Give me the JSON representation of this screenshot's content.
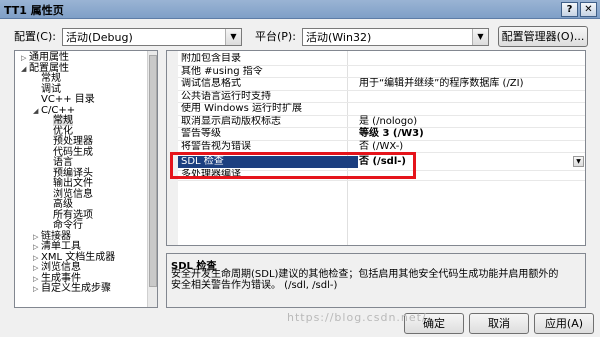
{
  "window": {
    "title": "TT1 属性页",
    "help": "?",
    "close": "✕"
  },
  "config": {
    "label": "配置(C):",
    "value": "活动(Debug)"
  },
  "platform": {
    "label": "平台(P):",
    "value": "活动(Win32)"
  },
  "config_manager": "配置管理器(O)...",
  "tree": [
    {
      "label": "通用属性",
      "indent": 0,
      "exp": "▷"
    },
    {
      "label": "配置属性",
      "indent": 0,
      "exp": "◢"
    },
    {
      "label": "常规",
      "indent": 1,
      "exp": ""
    },
    {
      "label": "调试",
      "indent": 1,
      "exp": ""
    },
    {
      "label": "VC++ 目录",
      "indent": 1,
      "exp": ""
    },
    {
      "label": "C/C++",
      "indent": 1,
      "exp": "◢"
    },
    {
      "label": "常规",
      "indent": 2,
      "exp": "",
      "selected": true
    },
    {
      "label": "优化",
      "indent": 2,
      "exp": ""
    },
    {
      "label": "预处理器",
      "indent": 2,
      "exp": ""
    },
    {
      "label": "代码生成",
      "indent": 2,
      "exp": ""
    },
    {
      "label": "语言",
      "indent": 2,
      "exp": ""
    },
    {
      "label": "预编译头",
      "indent": 2,
      "exp": ""
    },
    {
      "label": "输出文件",
      "indent": 2,
      "exp": ""
    },
    {
      "label": "浏览信息",
      "indent": 2,
      "exp": ""
    },
    {
      "label": "高级",
      "indent": 2,
      "exp": ""
    },
    {
      "label": "所有选项",
      "indent": 2,
      "exp": ""
    },
    {
      "label": "命令行",
      "indent": 2,
      "exp": ""
    },
    {
      "label": "链接器",
      "indent": 1,
      "exp": "▷"
    },
    {
      "label": "清单工具",
      "indent": 1,
      "exp": "▷"
    },
    {
      "label": "XML 文档生成器",
      "indent": 1,
      "exp": "▷"
    },
    {
      "label": "浏览信息",
      "indent": 1,
      "exp": "▷"
    },
    {
      "label": "生成事件",
      "indent": 1,
      "exp": "▷"
    },
    {
      "label": "自定义生成步骤",
      "indent": 1,
      "exp": "▷"
    }
  ],
  "grid": [
    {
      "name": "附加包含目录",
      "value": ""
    },
    {
      "name": "其他 #using 指令",
      "value": ""
    },
    {
      "name": "调试信息格式",
      "value": "用于“编辑并继续”的程序数据库 (/ZI)"
    },
    {
      "name": "公共语言运行时支持",
      "value": ""
    },
    {
      "name": "使用 Windows 运行时扩展",
      "value": ""
    },
    {
      "name": "取消显示启动版权标志",
      "value": "是 (/nologo)"
    },
    {
      "name": "警告等级",
      "value": "等级 3 (/W3)",
      "bold": true
    },
    {
      "name": "将警告视为错误",
      "value": "否 (/WX-)"
    },
    {
      "name": "SDL 检查",
      "value": "否 (/sdl-)",
      "selected": true
    },
    {
      "name": "多处理器编译",
      "value": ""
    }
  ],
  "description": {
    "title": "SDL 检查",
    "body": "安全开发生命周期(SDL)建议的其他检查；包括启用其他安全代码生成功能并启用额外的安全相关警告作为错误。          (/sdl, /sdl-)"
  },
  "buttons": {
    "ok": "确定",
    "cancel": "取消",
    "apply": "应用(A)"
  },
  "watermark": "https://blog.csdn.net/..."
}
